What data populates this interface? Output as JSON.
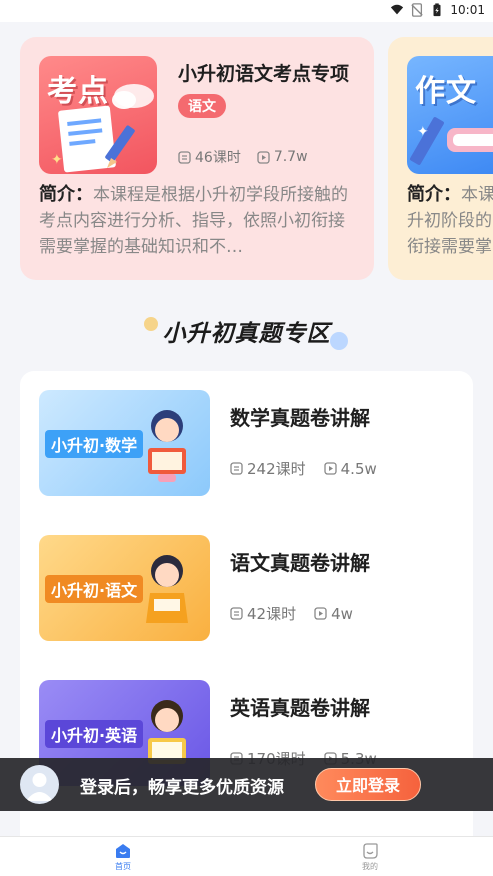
{
  "status_bar": {
    "time": "10:01"
  },
  "featured": [
    {
      "cover_label": "考点",
      "title": "小升初语文考点专项",
      "tag": "语文",
      "lessons": "46课时",
      "views": "7.7w",
      "intro_label": "简介：",
      "intro_text": "本课程是根据小升初学段所接触的考点内容进行分析、指导，依照小初衔接需要掌握的基础知识和不…"
    },
    {
      "cover_label": "作文",
      "intro_label": "简介：",
      "intro_text": "本课升初阶段的衔接需要掌"
    }
  ],
  "section": {
    "title": "小升初真题专区"
  },
  "courses": [
    {
      "cover_text": "小升初·数学",
      "title": "数学真题卷讲解",
      "lessons": "242课时",
      "views": "4.5w"
    },
    {
      "cover_text": "小升初·语文",
      "title": "语文真题卷讲解",
      "lessons": "42课时",
      "views": "4w"
    },
    {
      "cover_text": "小升初·英语",
      "title": "英语真题卷讲解",
      "lessons": "170课时",
      "views": "5.3w"
    }
  ],
  "login_banner": {
    "text": "登录后，畅享更多优质资源",
    "button": "立即登录"
  },
  "bottom_nav": {
    "home": "首页",
    "mine": "我的"
  },
  "colors": {
    "accent_blue": "#3a7cf0",
    "tag_red": "#f46a6f",
    "login_orange": "#f5623d"
  }
}
